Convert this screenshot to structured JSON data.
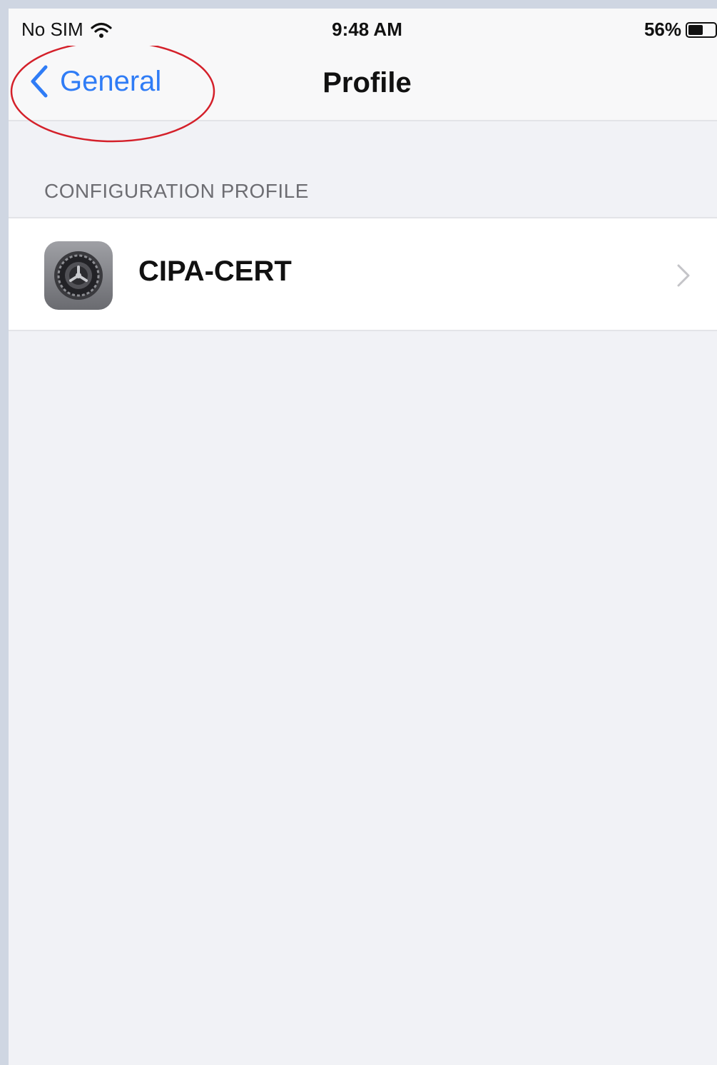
{
  "status_bar": {
    "carrier": "No SIM",
    "time": "9:48 AM",
    "battery_percent_label": "56%",
    "battery_level": 0.56
  },
  "nav": {
    "back_label": "General",
    "title": "Profile"
  },
  "section": {
    "header": "CONFIGURATION PROFILE",
    "rows": [
      {
        "label": "CIPA-CERT",
        "icon": "settings-gear-icon"
      }
    ]
  },
  "colors": {
    "accent": "#2f7cf6",
    "annotation": "#d4202a",
    "background": "#f1f2f6"
  }
}
